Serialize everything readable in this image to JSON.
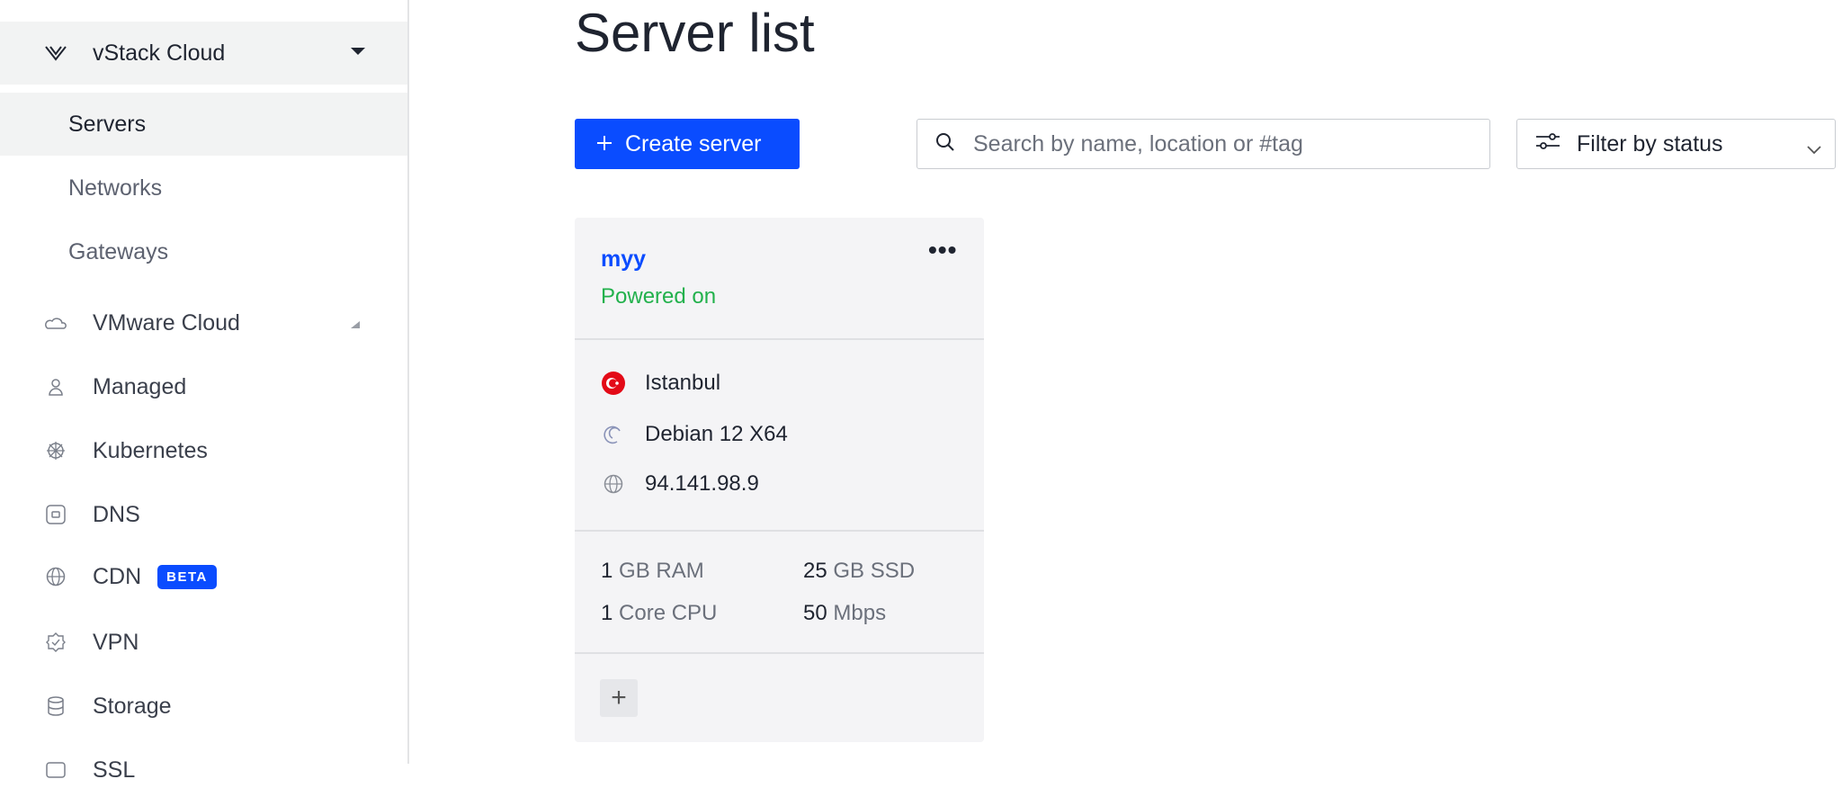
{
  "sidebar": {
    "group": {
      "label": "vStack Cloud"
    },
    "subitems": [
      {
        "label": "Servers"
      },
      {
        "label": "Networks"
      },
      {
        "label": "Gateways"
      }
    ],
    "items": [
      {
        "label": "VMware Cloud",
        "icon": "cloud-icon"
      },
      {
        "label": "Managed",
        "icon": "user-icon"
      },
      {
        "label": "Kubernetes",
        "icon": "helm-icon"
      },
      {
        "label": "DNS",
        "icon": "dns-icon"
      },
      {
        "label": "CDN",
        "icon": "globe-icon",
        "badge": "BETA"
      },
      {
        "label": "VPN",
        "icon": "shield-gear-icon"
      },
      {
        "label": "Storage",
        "icon": "database-icon"
      },
      {
        "label": "SSL",
        "icon": "ssl-icon"
      }
    ]
  },
  "main": {
    "title": "Server list",
    "create_label": "Create server",
    "search_placeholder": "Search by name, location or #tag",
    "filter_label": "Filter by status"
  },
  "server": {
    "name": "myy",
    "status": "Powered on",
    "status_color": "#22b14c",
    "location": "Istanbul",
    "os": "Debian 12 X64",
    "ip": "94.141.98.9",
    "ram_value": "1",
    "ram_unit": "GB RAM",
    "disk_value": "25",
    "disk_unit": "GB SSD",
    "cpu_value": "1",
    "cpu_unit": "Core CPU",
    "bw_value": "50",
    "bw_unit": "Mbps",
    "more": "•••",
    "add": "+"
  }
}
